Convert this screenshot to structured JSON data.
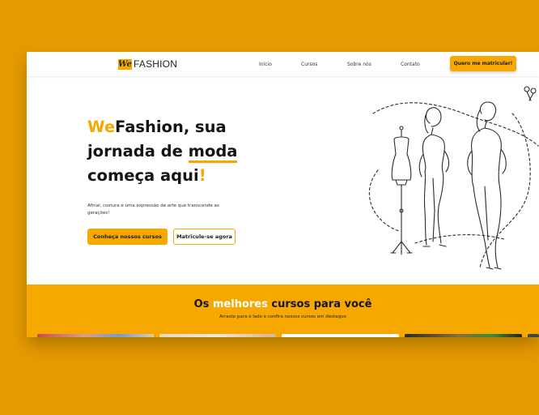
{
  "header": {
    "logo_mark": "We",
    "logo_text": "FASHION",
    "nav": [
      "Início",
      "Cursos",
      "Sobre nós",
      "Contato"
    ],
    "cta": "Quero me matricular!"
  },
  "hero": {
    "title_accent": "We",
    "title_line1": "Fashion, sua",
    "title_line2_a": "jornada de ",
    "title_line2_b": "moda",
    "title_line3": "começa aqui",
    "title_exclaim": "!",
    "description": "Afinal, costura é uma expressão de arte que transcende as gerações!",
    "primary_button": "Conheça nossos cursos",
    "secondary_button": "Matricule-se agora",
    "illustration": "fashion-sketch-illustration"
  },
  "courses": {
    "title_a": "Os ",
    "title_hl": "melhores",
    "title_b": " cursos para você",
    "subtitle": "Arraste para o lado e confira nossos cursos em destaque"
  },
  "colors": {
    "background": "#E59A00",
    "accent": "#F6A800",
    "text": "#151515"
  }
}
